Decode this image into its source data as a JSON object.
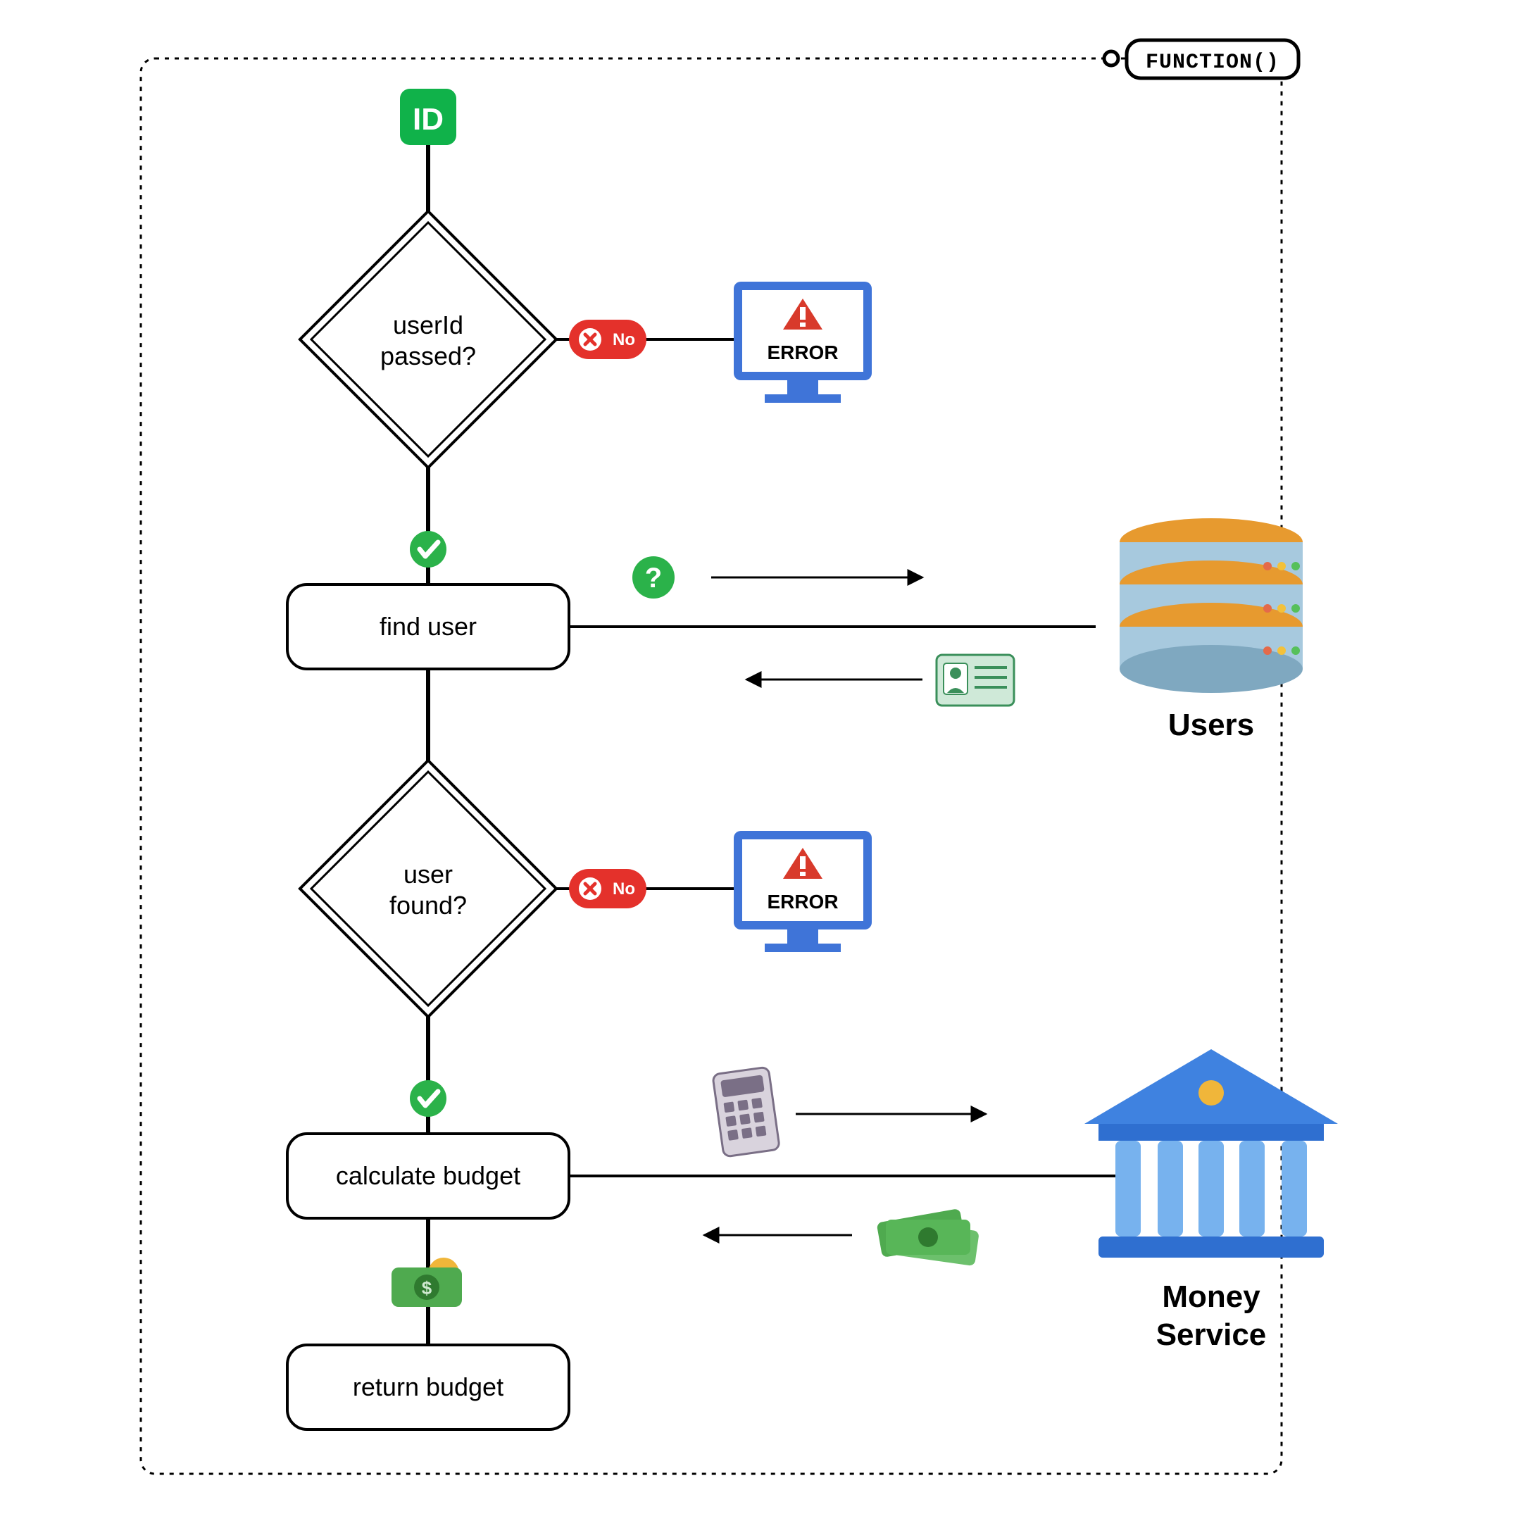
{
  "frame": {
    "label": "FUNCTION()"
  },
  "start": {
    "label": "ID"
  },
  "decisions": {
    "userIdPassed": {
      "line1": "userId",
      "line2": "passed?",
      "noLabel": "No"
    },
    "userFound": {
      "line1": "user",
      "line2": "found?",
      "noLabel": "No"
    }
  },
  "processes": {
    "findUser": {
      "label": "find user"
    },
    "calculateBudget": {
      "label": "calculate budget"
    },
    "returnBudget": {
      "label": "return budget"
    }
  },
  "errors": {
    "userIdError": {
      "label": "ERROR"
    },
    "userFoundError": {
      "label": "ERROR"
    }
  },
  "externals": {
    "users": {
      "label": "Users"
    },
    "moneyService": {
      "line1": "Money",
      "line2": "Service"
    }
  }
}
